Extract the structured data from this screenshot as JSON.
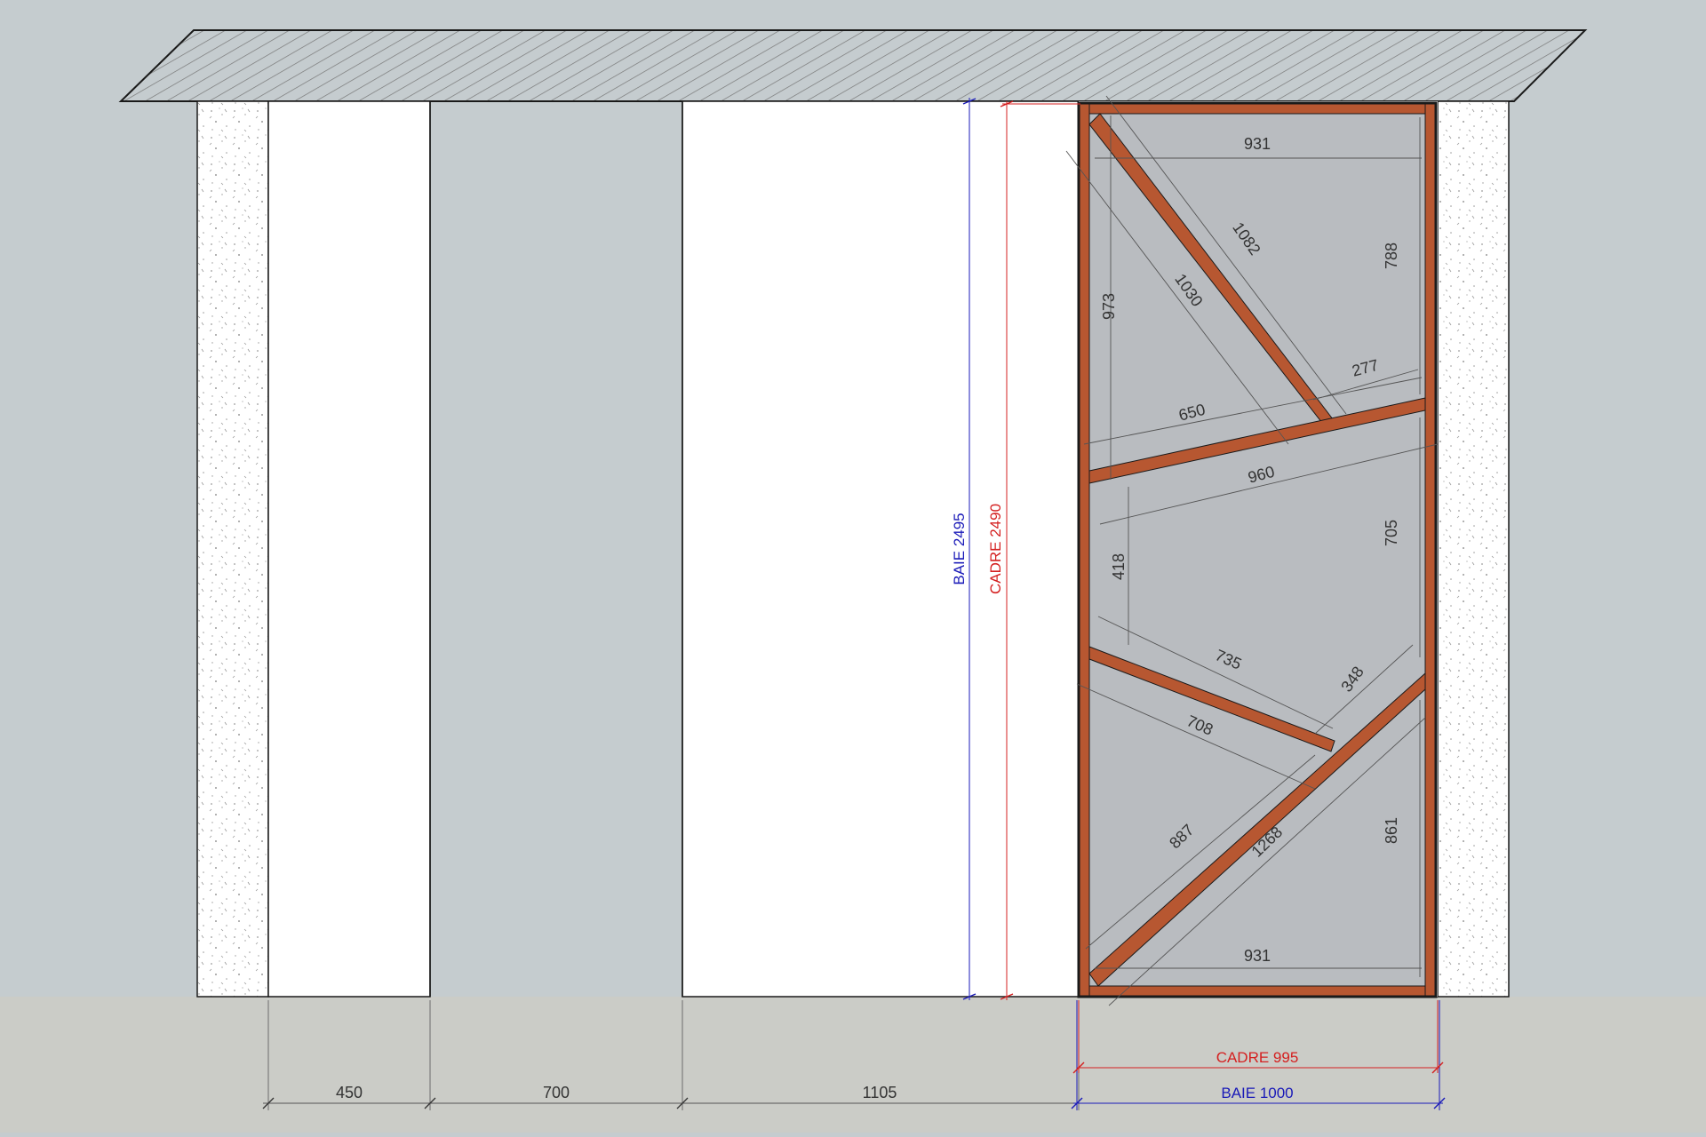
{
  "colors": {
    "background": "#c5cccf",
    "floor": "#cbccc7",
    "wall_fill": "#ffffff",
    "frame_brown": "#b75731",
    "glass": "#b9bcc0",
    "line_dark": "#1a1a1a",
    "dim_line": "#555555",
    "dim_text": "#333333",
    "baie_blue": "#1a1ab8",
    "cadre_red": "#d42020",
    "hatch_line": "#777777",
    "concrete_dot": "#9a9a9a"
  },
  "vertical_dims": {
    "baie": "BAIE 2495",
    "cadre": "CADRE 2490"
  },
  "horizontal_dims": {
    "cadre": "CADRE 995",
    "baie": "BAIE 1000",
    "seg1": "450",
    "seg2": "700",
    "seg3": "1105"
  },
  "frame_dims": {
    "top_width": "931",
    "bottom_width": "931",
    "d1082": "1082",
    "d1030": "1030",
    "d973": "973",
    "d788": "788",
    "d277": "277",
    "d650": "650",
    "d960": "960",
    "d418": "418",
    "d705": "705",
    "d735": "735",
    "d348": "348",
    "d708": "708",
    "d887": "887",
    "d1268": "1268",
    "d861": "861"
  }
}
